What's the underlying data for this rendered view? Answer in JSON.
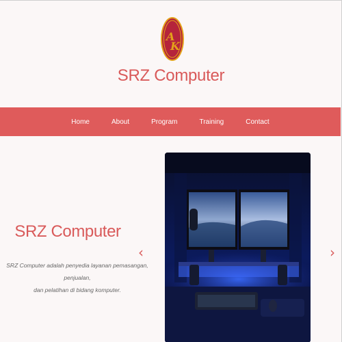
{
  "header": {
    "logo_alt": "AK",
    "site_title": "SRZ Computer"
  },
  "nav": {
    "items": [
      {
        "label": "Home"
      },
      {
        "label": "About"
      },
      {
        "label": "Program"
      },
      {
        "label": "Training"
      },
      {
        "label": "Contact"
      }
    ]
  },
  "hero": {
    "title": "SRZ Computer",
    "description_line1": "SRZ Computer adalah penyedia layanan pemasangan, penjualan,",
    "description_line2": "dan pelatihan di bidang komputer.",
    "prev_arrow": "‹",
    "next_arrow": "›",
    "image": "computer-setup-photo"
  },
  "colors": {
    "accent": "#df5b5b",
    "title": "#d95a5a",
    "background": "#fbf7f7"
  }
}
